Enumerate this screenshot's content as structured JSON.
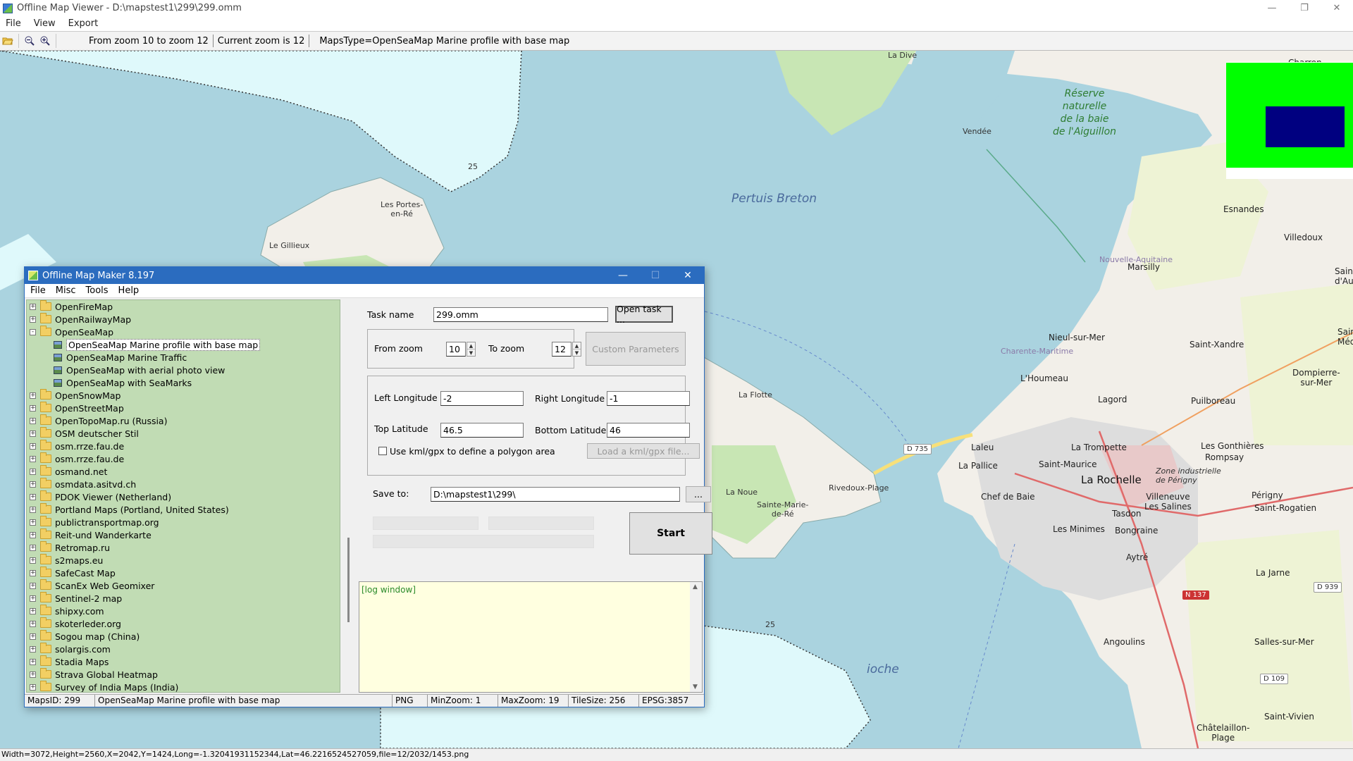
{
  "window": {
    "title": "Offline Map Viewer - D:\\mapstest1\\299\\299.omm",
    "controls": [
      "—",
      "❐",
      "✕"
    ]
  },
  "menu": [
    "File",
    "View",
    "Export"
  ],
  "toolbar": {
    "zoom_range": "From zoom 10 to zoom 12",
    "current_zoom": "Current zoom is 12",
    "maps_type": "MapsType=OpenSeaMap Marine profile with base map"
  },
  "map": {
    "water_labels": [
      "Pertuis Breton",
      "ioche"
    ],
    "reserve_label": [
      "Réserve",
      "naturelle",
      "de la baie",
      "de l'Aiguillon"
    ],
    "depth_labels": [
      "25",
      "25"
    ],
    "small_labels": [
      "La Dive",
      "Vendée",
      "Le Gillieux",
      "Les Portes-\nen-Ré",
      "La Flotte",
      "La Noue",
      "Sainte-Marie-\nde-Ré",
      "Rivedoux-Plage",
      "Charente-Maritime",
      "Nouvelle-Aquitaine",
      "Zone industrielle\nde Périgny"
    ],
    "towns": [
      "Charron",
      "Esnandes",
      "Villedoux",
      "Marsilly",
      "Nieul-sur-Mer",
      "Saint-Xandre",
      "L'Houmeau",
      "Lagord",
      "Puilboreau",
      "Dompierre-\nsur-Mer",
      "Laleu",
      "La Trompette",
      "Les Gonthières",
      "Rompsay",
      "La Pallice",
      "Saint-Maurice",
      "Chef de Baie",
      "Villeneuve\nLes Salines",
      "Périgny",
      "Tasdon",
      "Les Minimes",
      "Bongraine",
      "Saint-Rogatien",
      "Aytré",
      "La Jarne",
      "Angoulins",
      "Salles-sur-Mer",
      "Saint-Vivien",
      "Châtelaillon-\nPlage",
      "Saint\nd'Au",
      "Saint\nMéd"
    ],
    "city": "La Rochelle",
    "roads": [
      "D 735",
      "N 137",
      "D 939",
      "D 109"
    ]
  },
  "statusbar": "Width=3072,Height=2560,X=2042,Y=1424,Long=-1.32041931152344,Lat=46.2216524527059,file=12/2032/1453.png",
  "dialog": {
    "title": "Offline Map Maker 8.197",
    "controls": [
      "—",
      "☐",
      "✕"
    ],
    "menu": [
      "File",
      "Misc",
      "Tools",
      "Help"
    ],
    "tree": [
      {
        "label": "OpenFireMap",
        "type": "folder",
        "state": "+"
      },
      {
        "label": "OpenRailwayMap",
        "type": "folder",
        "state": "+"
      },
      {
        "label": "OpenSeaMap",
        "type": "folder",
        "state": "-"
      },
      {
        "label": "OpenSeaMap Marine profile with base map",
        "type": "leaf",
        "selected": true
      },
      {
        "label": "OpenSeaMap Marine Traffic",
        "type": "leaf"
      },
      {
        "label": "OpenSeaMap with aerial photo view",
        "type": "leaf"
      },
      {
        "label": "OpenSeaMap with SeaMarks",
        "type": "leaf"
      },
      {
        "label": "OpenSnowMap",
        "type": "folder",
        "state": "+"
      },
      {
        "label": "OpenStreetMap",
        "type": "folder",
        "state": "+"
      },
      {
        "label": "OpenTopoMap.ru (Russia)",
        "type": "folder",
        "state": "+"
      },
      {
        "label": "OSM deutscher Stil",
        "type": "folder",
        "state": "+"
      },
      {
        "label": "osm.rrze.fau.de",
        "type": "folder",
        "state": "+"
      },
      {
        "label": "osm.rrze.fau.de",
        "type": "folder",
        "state": "+"
      },
      {
        "label": "osmand.net",
        "type": "folder",
        "state": "+"
      },
      {
        "label": "osmdata.asitvd.ch",
        "type": "folder",
        "state": "+"
      },
      {
        "label": "PDOK Viewer (Netherland)",
        "type": "folder",
        "state": "+"
      },
      {
        "label": "Portland Maps (Portland, United States)",
        "type": "folder",
        "state": "+"
      },
      {
        "label": "publictransportmap.org",
        "type": "folder",
        "state": "+"
      },
      {
        "label": "Reit-und Wanderkarte",
        "type": "folder",
        "state": "+"
      },
      {
        "label": "Retromap.ru",
        "type": "folder",
        "state": "+"
      },
      {
        "label": "s2maps.eu",
        "type": "folder",
        "state": "+"
      },
      {
        "label": "SafeCast Map",
        "type": "folder",
        "state": "+"
      },
      {
        "label": "ScanEx Web Geomixer",
        "type": "folder",
        "state": "+"
      },
      {
        "label": "Sentinel-2 map",
        "type": "folder",
        "state": "+"
      },
      {
        "label": "shipxy.com",
        "type": "folder",
        "state": "+"
      },
      {
        "label": "skoterleder.org",
        "type": "folder",
        "state": "+"
      },
      {
        "label": "Sogou map (China)",
        "type": "folder",
        "state": "+"
      },
      {
        "label": "solargis.com",
        "type": "folder",
        "state": "+"
      },
      {
        "label": "Stadia Maps",
        "type": "folder",
        "state": "+"
      },
      {
        "label": "Strava Global Heatmap",
        "type": "folder",
        "state": "+"
      },
      {
        "label": "Survey of India Maps (India)",
        "type": "folder",
        "state": "+"
      }
    ],
    "task_name_label": "Task name",
    "task_name_value": "299.omm",
    "open_task_label": "Open task ...",
    "from_zoom_label": "From zoom",
    "from_zoom_value": "10",
    "to_zoom_label": "To zoom",
    "to_zoom_value": "12",
    "custom_params_label": "Custom Parameters",
    "left_lon_label": "Left Longitude",
    "left_lon_value": "-2",
    "right_lon_label": "Right Longitude",
    "right_lon_value": "-1",
    "top_lat_label": "Top Latitude",
    "top_lat_value": "46.5",
    "bottom_lat_label": "Bottom Latitude",
    "bottom_lat_value": "46",
    "kml_check_label": "Use kml/gpx to define a polygon area",
    "load_kml_label": "Load a kml/gpx file...",
    "save_to_label": "Save to:",
    "save_to_value": "D:\\mapstest1\\299\\",
    "browse_label": "...",
    "start_label": "Start",
    "log_text": "[log window]",
    "status": {
      "maps_id": "MapsID: 299",
      "maps_name": "OpenSeaMap Marine profile with base map",
      "format": "PNG",
      "min_zoom": "MinZoom: 1",
      "max_zoom": "MaxZoom: 19",
      "tile_size": "TileSize: 256",
      "epsg": "EPSG:3857"
    }
  },
  "colors": {
    "water": "#aad3df",
    "shallow": "#dff9fb",
    "land": "#f2efe9",
    "urban": "#dddddd",
    "green": "#c8e6b4",
    "dialog_accent": "#2b6cbf",
    "tree_bg": "#c1dcb4",
    "minimap_bg": "#00ff00",
    "minimap_viewport": "#000080"
  }
}
